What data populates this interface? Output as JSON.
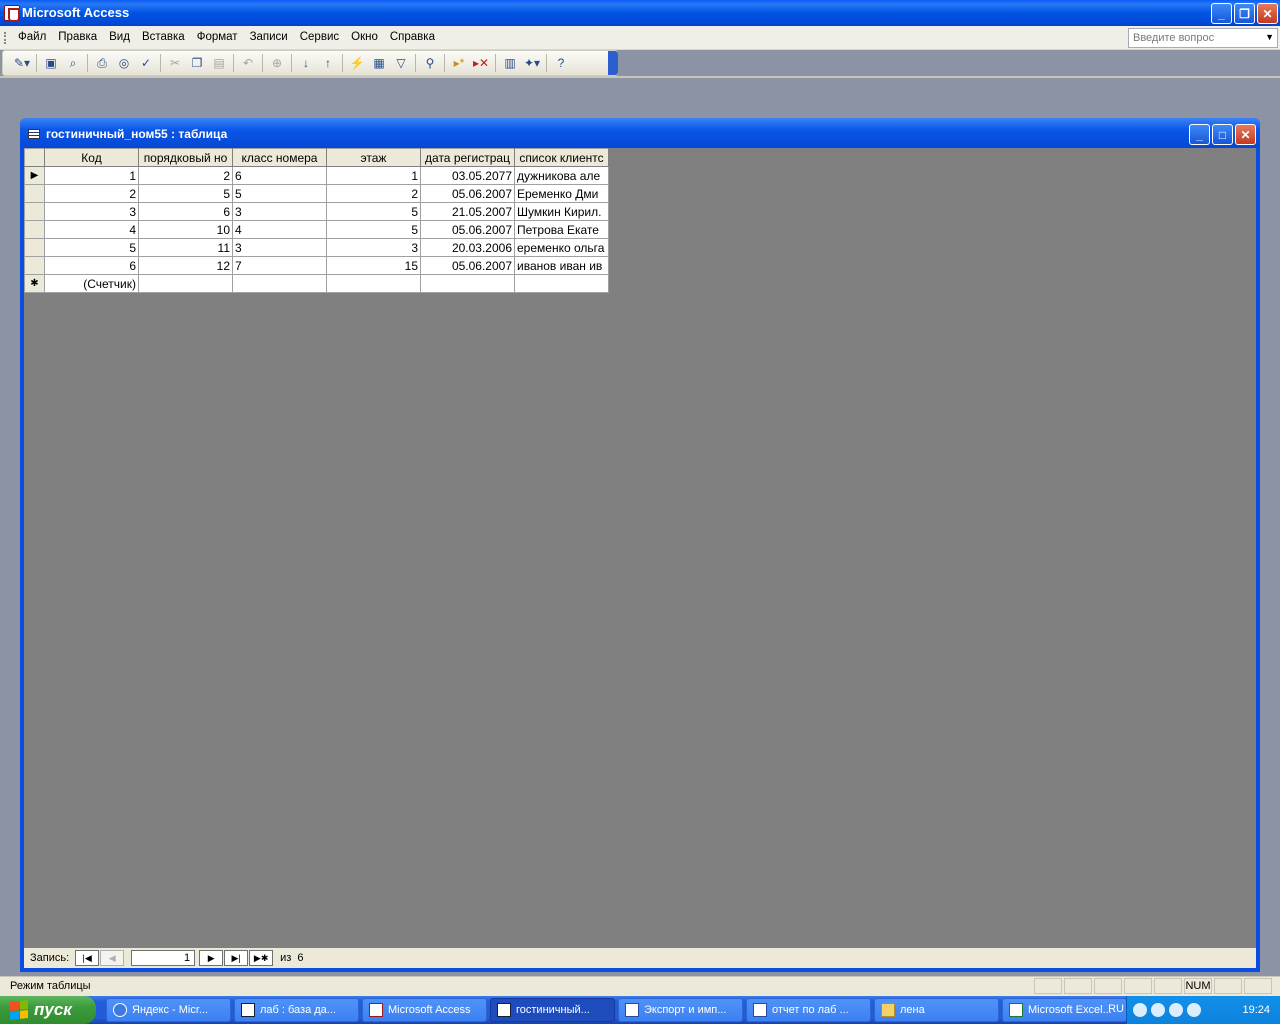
{
  "app": {
    "title": "Microsoft Access"
  },
  "menu": {
    "items": [
      {
        "label": "Файл"
      },
      {
        "label": "Правка"
      },
      {
        "label": "Вид"
      },
      {
        "label": "Вставка"
      },
      {
        "label": "Формат"
      },
      {
        "label": "Записи"
      },
      {
        "label": "Сервис"
      },
      {
        "label": "Окно"
      },
      {
        "label": "Справка"
      }
    ],
    "ask_placeholder": "Введите вопрос"
  },
  "toolbar": {
    "icons": [
      "view-icon",
      "save-icon",
      "search-icon",
      "print-icon",
      "print-preview-icon",
      "spelling-icon",
      "cut-icon",
      "copy-icon",
      "paste-icon",
      "undo-icon",
      "hyperlink-icon",
      "sort-asc-icon",
      "sort-desc-icon",
      "filter-by-selection-icon",
      "filter-by-form-icon",
      "apply-filter-icon",
      "find-icon",
      "new-record-icon",
      "delete-record-icon",
      "database-window-icon",
      "new-object-icon",
      "help-icon"
    ]
  },
  "table_window": {
    "title": "гостиничный_ном55 : таблица",
    "columns": [
      "Код",
      "порядковый но",
      "класс номера",
      "этаж",
      "дата регистрац",
      "список клиентс"
    ],
    "rows": [
      [
        "1",
        "2",
        "6",
        "1",
        "03.05.2077",
        "дужникова але"
      ],
      [
        "2",
        "5",
        "5",
        "2",
        "05.06.2007",
        "Еременко Дми"
      ],
      [
        "3",
        "6",
        "3",
        "5",
        "21.05.2007",
        "Шумкин Кирил."
      ],
      [
        "4",
        "10",
        "4",
        "5",
        "05.06.2007",
        "Петрова Екате"
      ],
      [
        "5",
        "11",
        "3",
        "3",
        "20.03.2006",
        "еременко ольга"
      ],
      [
        "6",
        "12",
        "7",
        "15",
        "05.06.2007",
        "иванов иван ив"
      ]
    ],
    "new_row_placeholder": "(Счетчик)",
    "navigator": {
      "label": "Запись:",
      "current": "1",
      "of_label": "из",
      "total": "6"
    }
  },
  "status": {
    "text": "Режим таблицы",
    "num": "NUM"
  },
  "taskbar": {
    "start": "пуск",
    "tasks": [
      {
        "label": "Яндекс - Micr...",
        "icon": "ie"
      },
      {
        "label": "лаб : база да...",
        "icon": "access"
      },
      {
        "label": "Microsoft Access",
        "icon": "access"
      },
      {
        "label": "гостиничный...",
        "icon": "table"
      },
      {
        "label": "Экспорт и имп...",
        "icon": "word"
      },
      {
        "label": "отчет по лаб ...",
        "icon": "word"
      },
      {
        "label": "лена",
        "icon": "folder"
      },
      {
        "label": "Microsoft Excel...",
        "icon": "excel"
      }
    ],
    "language": "RU",
    "clock": "19:24"
  }
}
